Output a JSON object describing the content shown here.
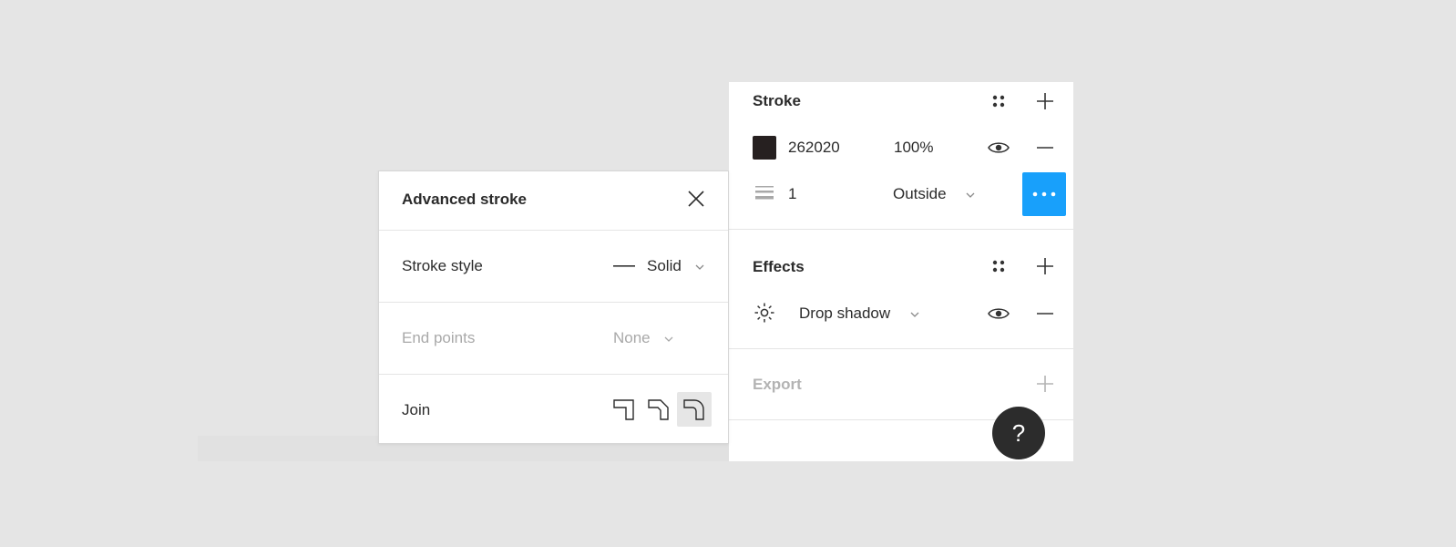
{
  "panel": {
    "stroke": {
      "title": "Stroke",
      "color_hex": "262020",
      "swatch_color": "#262020",
      "opacity": "100%",
      "weight": "1",
      "position": "Outside"
    },
    "effects": {
      "title": "Effects",
      "effect_type": "Drop shadow"
    },
    "export": {
      "title": "Export"
    },
    "help_label": "?"
  },
  "popover": {
    "title": "Advanced stroke",
    "stroke_style_label": "Stroke style",
    "stroke_style_value": "Solid",
    "end_points_label": "End points",
    "end_points_value": "None",
    "join_label": "Join",
    "join_selected": "round"
  },
  "colors": {
    "accent": "#18a0fb",
    "help_bg": "#2c2c2c"
  }
}
